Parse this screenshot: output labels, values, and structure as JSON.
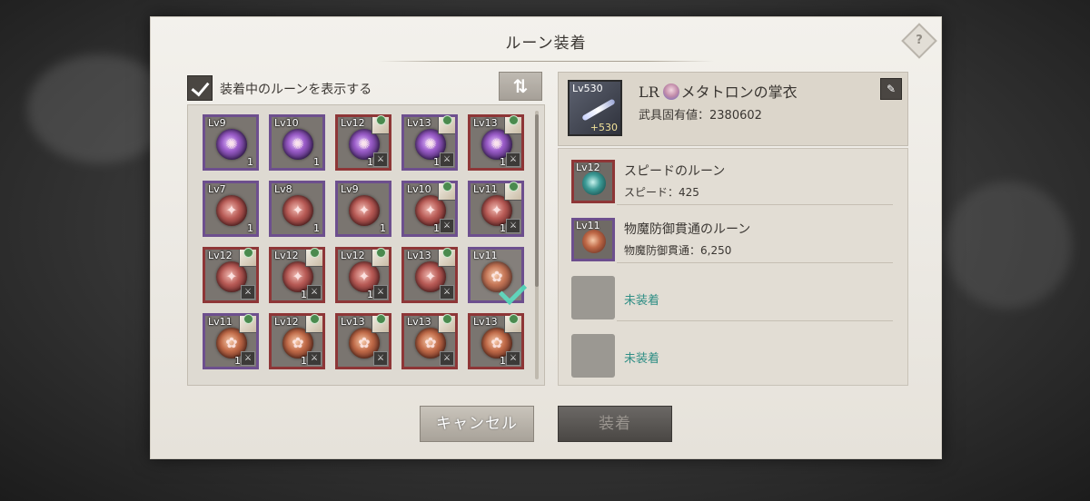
{
  "dialog": {
    "title": "ルーン装着",
    "help_icon": "?"
  },
  "filter": {
    "checked": true,
    "label": "装着中のルーンを表示する",
    "sort_icon": "⇅"
  },
  "runes": [
    {
      "level": "Lv9",
      "color": "purple",
      "orb": "purple",
      "count": "1",
      "thumb": false
    },
    {
      "level": "Lv10",
      "color": "purple",
      "orb": "purple",
      "count": "1",
      "thumb": false
    },
    {
      "level": "Lv12",
      "color": "red",
      "orb": "purple",
      "count": "1",
      "thumb": true
    },
    {
      "level": "Lv13",
      "color": "purple",
      "orb": "purple",
      "count": "1",
      "thumb": true
    },
    {
      "level": "Lv13",
      "color": "red",
      "orb": "purple",
      "count": "1",
      "thumb": true
    },
    {
      "level": "Lv7",
      "color": "purple",
      "orb": "crimson",
      "count": "1",
      "thumb": false
    },
    {
      "level": "Lv8",
      "color": "purple",
      "orb": "crimson",
      "count": "1",
      "thumb": false
    },
    {
      "level": "Lv9",
      "color": "purple",
      "orb": "crimson",
      "count": "1",
      "thumb": false
    },
    {
      "level": "Lv10",
      "color": "purple",
      "orb": "crimson",
      "count": "1",
      "thumb": true
    },
    {
      "level": "Lv11",
      "color": "purple",
      "orb": "crimson",
      "count": "1",
      "thumb": true
    },
    {
      "level": "Lv12",
      "color": "red",
      "orb": "crimson",
      "count": "",
      "thumb": true
    },
    {
      "level": "Lv12",
      "color": "red",
      "orb": "crimson",
      "count": "1",
      "thumb": true
    },
    {
      "level": "Lv12",
      "color": "red",
      "orb": "crimson",
      "count": "1",
      "thumb": true
    },
    {
      "level": "Lv13",
      "color": "red",
      "orb": "crimson",
      "count": "",
      "thumb": true
    },
    {
      "level": "Lv11",
      "color": "purple",
      "orb": "rust",
      "count": "",
      "thumb": false,
      "selected": true
    },
    {
      "level": "Lv11",
      "color": "purple",
      "orb": "rust",
      "count": "1",
      "thumb": true
    },
    {
      "level": "Lv12",
      "color": "red",
      "orb": "rust",
      "count": "1",
      "thumb": true
    },
    {
      "level": "Lv13",
      "color": "red",
      "orb": "rust",
      "count": "",
      "thumb": true
    },
    {
      "level": "Lv13",
      "color": "red",
      "orb": "rust",
      "count": "",
      "thumb": true
    },
    {
      "level": "Lv13",
      "color": "red",
      "orb": "rust",
      "count": "1",
      "thumb": true
    }
  ],
  "equipment": {
    "level": "Lv530",
    "plus": "+530",
    "rarity": "LR",
    "name": "メタトロンの掌衣",
    "value_label": "武具固有値：2380602"
  },
  "slots": [
    {
      "level": "Lv12",
      "frame": "red",
      "orb": "teal",
      "name": "スピードのルーン",
      "stat": "スピード：425"
    },
    {
      "level": "Lv11",
      "frame": "purple",
      "orb": "rust",
      "name": "物魔防御貫通のルーン",
      "stat": "物魔防御貫通：6,250"
    },
    {
      "empty_label": "未装着"
    },
    {
      "empty_label": "未装着"
    }
  ],
  "buttons": {
    "cancel": "キャンセル",
    "equip": "装着"
  },
  "colors": {
    "purple_frame": "#6d4f8e",
    "red_frame": "#8e3637",
    "empty_text": "#2f8e85",
    "check": "#54d1b6"
  }
}
